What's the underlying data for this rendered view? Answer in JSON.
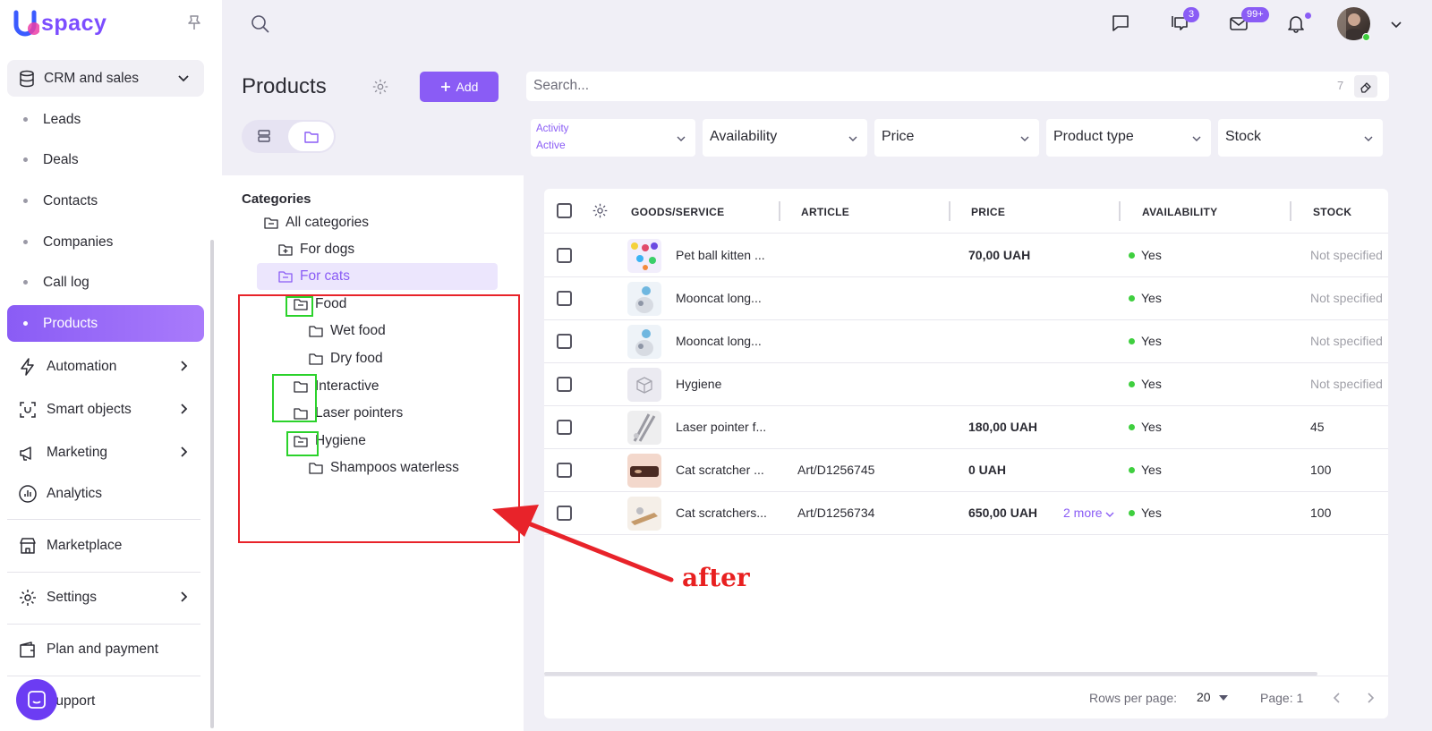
{
  "brand": {
    "logo_text": "spacy",
    "logo_letter": "U"
  },
  "sidebar": {
    "section": {
      "label": "CRM and sales"
    },
    "sub_items": [
      {
        "label": "Leads",
        "active": false
      },
      {
        "label": "Deals",
        "active": false
      },
      {
        "label": "Contacts",
        "active": false
      },
      {
        "label": "Companies",
        "active": false
      },
      {
        "label": "Call log",
        "active": false
      },
      {
        "label": "Products",
        "active": true
      }
    ],
    "nav_items": [
      {
        "label": "Automation",
        "icon": "lightning-icon"
      },
      {
        "label": "Smart objects",
        "icon": "smart-objects-icon"
      },
      {
        "label": "Marketing",
        "icon": "megaphone-icon"
      },
      {
        "label": "Analytics",
        "icon": "analytics-icon"
      },
      {
        "label": "Marketplace",
        "icon": "store-icon"
      },
      {
        "label": "Settings",
        "icon": "gear-icon"
      },
      {
        "label": "Plan and payment",
        "icon": "wallet-icon"
      },
      {
        "label": "Support",
        "icon": "support-icon"
      }
    ]
  },
  "header": {
    "chat_badge": "3",
    "mail_badge": "99+"
  },
  "toolbar": {
    "title": "Products",
    "add_label": "Add",
    "search_placeholder": "Search...",
    "search_count": "7"
  },
  "filters": {
    "activity_label": "Activity",
    "activity_value": "Active",
    "availability": "Availability",
    "price": "Price",
    "product_type": "Product type",
    "stock": "Stock"
  },
  "categories": {
    "heading": "Categories",
    "items": [
      {
        "label": "All categories",
        "selected": false
      },
      {
        "label": "For dogs",
        "selected": false
      },
      {
        "label": "For cats",
        "selected": true
      },
      {
        "label": "Food",
        "selected": false
      },
      {
        "label": "Wet food",
        "selected": false
      },
      {
        "label": "Dry food",
        "selected": false
      },
      {
        "label": "Interactive",
        "selected": false
      },
      {
        "label": "Laser pointers",
        "selected": false
      },
      {
        "label": "Hygiene",
        "selected": false
      },
      {
        "label": "Shampoos waterless",
        "selected": false
      }
    ]
  },
  "table": {
    "columns": [
      "GOODS/SERVICE",
      "ARTICLE",
      "PRICE",
      "AVAILABILITY",
      "STOCK"
    ],
    "rows": [
      {
        "name": "Pet ball kitten ...",
        "article": "",
        "price": "70,00 UAH",
        "more": "",
        "availability": "Yes",
        "stock": "Not specified",
        "thumb_color": "#f2eefc"
      },
      {
        "name": "Mooncat long...",
        "article": "",
        "price": "",
        "more": "",
        "availability": "Yes",
        "stock": "Not specified",
        "thumb_color": "#eef3f8"
      },
      {
        "name": "Mooncat long...",
        "article": "",
        "price": "",
        "more": "",
        "availability": "Yes",
        "stock": "Not specified",
        "thumb_color": "#eef3f8"
      },
      {
        "name": "Hygiene",
        "article": "",
        "price": "",
        "more": "",
        "availability": "Yes",
        "stock": "Not specified",
        "thumb_color": "#ebeaf1"
      },
      {
        "name": "Laser pointer f...",
        "article": "",
        "price": "180,00 UAH",
        "more": "",
        "availability": "Yes",
        "stock": "45",
        "thumb_color": "#eeeeef"
      },
      {
        "name": "Cat scratcher ...",
        "article": "Art/D1256745",
        "price": "0 UAH",
        "more": "",
        "availability": "Yes",
        "stock": "100",
        "thumb_color": "#f3d8cc"
      },
      {
        "name": "Cat scratchers...",
        "article": "Art/D1256734",
        "price": "650,00 UAH",
        "more": "2 more",
        "availability": "Yes",
        "stock": "100",
        "thumb_color": "#f5efe8"
      }
    ],
    "rows_per_page_label": "Rows per page:",
    "rows_per_page_value": "20",
    "page_label": "Page: 1"
  },
  "annotation": {
    "text": "after"
  },
  "colors": {
    "accent": "#8a5cf5",
    "annotation_red": "#e8232a",
    "annotation_green": "#2bd22b"
  }
}
